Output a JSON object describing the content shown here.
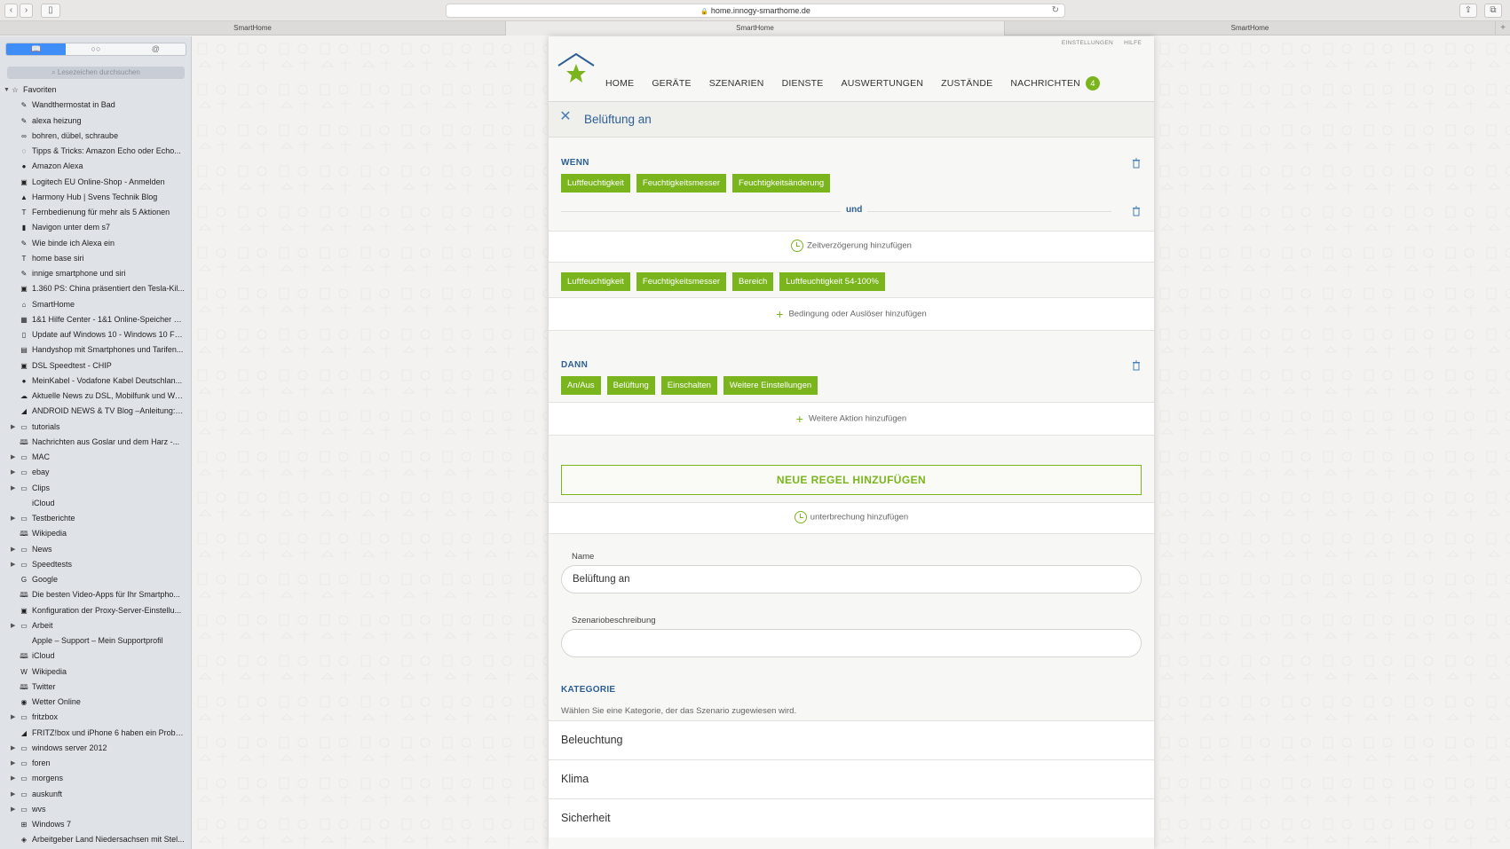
{
  "browser": {
    "url": "home.innogy-smarthome.de",
    "tabs": [
      "SmartHome",
      "SmartHome",
      "SmartHome"
    ],
    "new_tab": "+"
  },
  "sidebar": {
    "segments": [
      "📖",
      "○○",
      "@"
    ],
    "search_placeholder": "Lesezeichen durchsuchen",
    "root_label": "Favoriten",
    "items": [
      {
        "label": "Wandthermostat in Bad",
        "icon": "✎",
        "folder": false
      },
      {
        "label": "alexa heizung",
        "icon": "✎",
        "folder": false
      },
      {
        "label": "bohren, dübel, schraube",
        "icon": "∞",
        "folder": false
      },
      {
        "label": "Tipps & Tricks: Amazon Echo oder Echo...",
        "icon": "◌",
        "folder": false
      },
      {
        "label": "Amazon Alexa",
        "icon": "●",
        "folder": false
      },
      {
        "label": "Logitech EU Online-Shop - Anmelden",
        "icon": "▣",
        "folder": false
      },
      {
        "label": "Harmony Hub | Svens Technik Blog",
        "icon": "▲",
        "folder": false
      },
      {
        "label": "Fernbedienung für mehr als 5 Aktionen",
        "icon": "T",
        "folder": false
      },
      {
        "label": "Navigon unter dem s7",
        "icon": "▮",
        "folder": false
      },
      {
        "label": "Wie binde ich Alexa ein",
        "icon": "✎",
        "folder": false
      },
      {
        "label": "home base siri",
        "icon": "T",
        "folder": false
      },
      {
        "label": "innige smartphone und siri",
        "icon": "✎",
        "folder": false
      },
      {
        "label": "1.360 PS: China präsentiert den Tesla-Kil...",
        "icon": "▣",
        "folder": false
      },
      {
        "label": "SmartHome",
        "icon": "⌂",
        "folder": false
      },
      {
        "label": "1&1 Hilfe Center - 1&1 Online-Speicher al...",
        "icon": "▦",
        "folder": false
      },
      {
        "label": "Update auf Windows 10 - Windows 10 Fo...",
        "icon": "▯",
        "folder": false
      },
      {
        "label": "Handyshop mit Smartphones und Tarifen...",
        "icon": "▤",
        "folder": false
      },
      {
        "label": "DSL Speedtest - CHIP",
        "icon": "▣",
        "folder": false
      },
      {
        "label": "MeinKabel - Vodafone Kabel Deutschlan...",
        "icon": "●",
        "folder": false
      },
      {
        "label": "Aktuelle News zu DSL, Mobilfunk und We...",
        "icon": "☁",
        "folder": false
      },
      {
        "label": "ANDROID NEWS & TV Blog –Anleitung: S...",
        "icon": "◢",
        "folder": false
      },
      {
        "label": "tutorials",
        "icon": "▭",
        "folder": true
      },
      {
        "label": "Nachrichten aus Goslar und dem Harz -...",
        "icon": "🕮",
        "folder": false
      },
      {
        "label": "MAC",
        "icon": "▭",
        "folder": true
      },
      {
        "label": "ebay",
        "icon": "▭",
        "folder": true
      },
      {
        "label": "Clips",
        "icon": "▭",
        "folder": true
      },
      {
        "label": "iCloud",
        "icon": "",
        "folder": false
      },
      {
        "label": "Testberichte",
        "icon": "▭",
        "folder": true
      },
      {
        "label": "Wikipedia",
        "icon": "🕮",
        "folder": false
      },
      {
        "label": "News",
        "icon": "▭",
        "folder": true
      },
      {
        "label": "Speedtests",
        "icon": "▭",
        "folder": true
      },
      {
        "label": "Google",
        "icon": "G",
        "folder": false
      },
      {
        "label": "Die besten Video-Apps für Ihr Smartpho...",
        "icon": "🕮",
        "folder": false
      },
      {
        "label": "Konfiguration der Proxy-Server-Einstellu...",
        "icon": "▣",
        "folder": false
      },
      {
        "label": "Arbeit",
        "icon": "▭",
        "folder": true
      },
      {
        "label": "Apple – Support – Mein Supportprofil",
        "icon": "",
        "folder": false
      },
      {
        "label": "iCloud",
        "icon": "🕮",
        "folder": false
      },
      {
        "label": "Wikipedia",
        "icon": "W",
        "folder": false
      },
      {
        "label": "Twitter",
        "icon": "🕮",
        "folder": false
      },
      {
        "label": "Wetter Online",
        "icon": "◉",
        "folder": false
      },
      {
        "label": "fritzbox",
        "icon": "▭",
        "folder": true
      },
      {
        "label": "FRITZ!box und iPhone 6 haben ein Proble...",
        "icon": "◢",
        "folder": false
      },
      {
        "label": "windows server 2012",
        "icon": "▭",
        "folder": true
      },
      {
        "label": "foren",
        "icon": "▭",
        "folder": true
      },
      {
        "label": "morgens",
        "icon": "▭",
        "folder": true
      },
      {
        "label": "auskunft",
        "icon": "▭",
        "folder": true
      },
      {
        "label": "wvs",
        "icon": "▭",
        "folder": true
      },
      {
        "label": "Windows 7",
        "icon": "⊞",
        "folder": false
      },
      {
        "label": "Arbeitgeber Land Niedersachsen mit Stel...",
        "icon": "◈",
        "folder": false
      }
    ]
  },
  "app": {
    "top_links": [
      "EINSTELLUNGEN",
      "HILFE"
    ],
    "nav": [
      "HOME",
      "GERÄTE",
      "SZENARIEN",
      "DIENSTE",
      "AUSWERTUNGEN",
      "ZUSTÄNDE",
      "NACHRICHTEN"
    ],
    "nav_badge": "4",
    "page_title": "Belüftung an",
    "wenn": {
      "label": "WENN",
      "chips_1": [
        "Luftfeuchtigkeit",
        "Feuchtigkeitsmesser",
        "Feuchtigkeitsänderung"
      ],
      "and_label": "und",
      "delay_action": "Zeitverzögerung hinzufügen",
      "chips_2": [
        "Luftfeuchtigkeit",
        "Feuchtigkeitsmesser",
        "Bereich",
        "Luftfeuchtigkeit 54-100%"
      ],
      "add_condition": "Bedingung oder Auslöser hinzufügen"
    },
    "dann": {
      "label": "DANN",
      "chips": [
        "An/Aus",
        "Belüftung",
        "Einschalten",
        "Weitere Einstellungen"
      ],
      "add_action": "Weitere Aktion hinzufügen"
    },
    "new_rule_button": "NEUE REGEL HINZUFÜGEN",
    "interruption_action": "unterbrechung hinzufügen",
    "form": {
      "name_label": "Name",
      "name_value": "Belüftung an",
      "desc_label": "Szenariobeschreibung",
      "desc_value": ""
    },
    "kategorie": {
      "label": "KATEGORIE",
      "description": "Wählen Sie eine Kategorie, der das Szenario zugewiesen wird.",
      "options": [
        "Beleuchtung",
        "Klima",
        "Sicherheit"
      ]
    },
    "colors": {
      "accent_green": "#7ab51d",
      "title_blue": "#2d5f95"
    }
  }
}
